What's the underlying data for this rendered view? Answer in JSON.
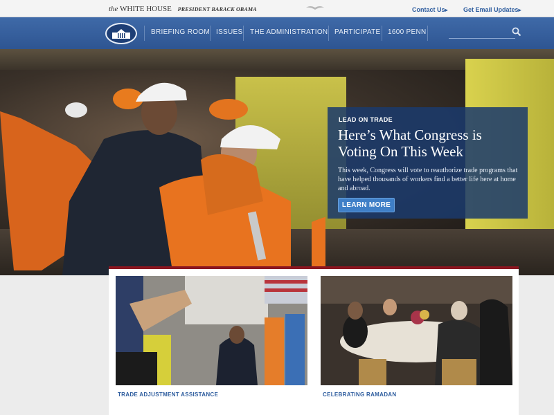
{
  "topbar": {
    "brand_the": "the",
    "brand_name": "WHITE HOUSE",
    "brand_president": "PRESIDENT BARACK OBAMA",
    "contact_link": "Contact Us",
    "updates_link": "Get Email Updates"
  },
  "nav": {
    "items": [
      "BRIEFING ROOM",
      "ISSUES",
      "THE ADMINISTRATION",
      "PARTICIPATE",
      "1600 PENN"
    ],
    "search_placeholder": ""
  },
  "hero": {
    "kicker": "LEAD ON TRADE",
    "headline": "Here’s What Congress is Voting On This Week",
    "body": "This week, Congress will vote to reauthorize trade programs that have helped thousands of workers find a better life here at home and abroad.",
    "button_label": "LEARN MORE"
  },
  "features": [
    {
      "label": "TRADE ADJUSTMENT ASSISTANCE"
    },
    {
      "label": "CELEBRATING RAMADAN"
    }
  ],
  "colors": {
    "nav_blue": "#2e5592",
    "panel_blue": "#1b3a6c",
    "accent_red": "#8a1620",
    "link_blue": "#2d5c9e",
    "button_blue": "#3f7fc7"
  },
  "icons": [
    "white-house-logo-icon",
    "search-icon",
    "eagle-seal-icon",
    "chevron-right-icon"
  ]
}
